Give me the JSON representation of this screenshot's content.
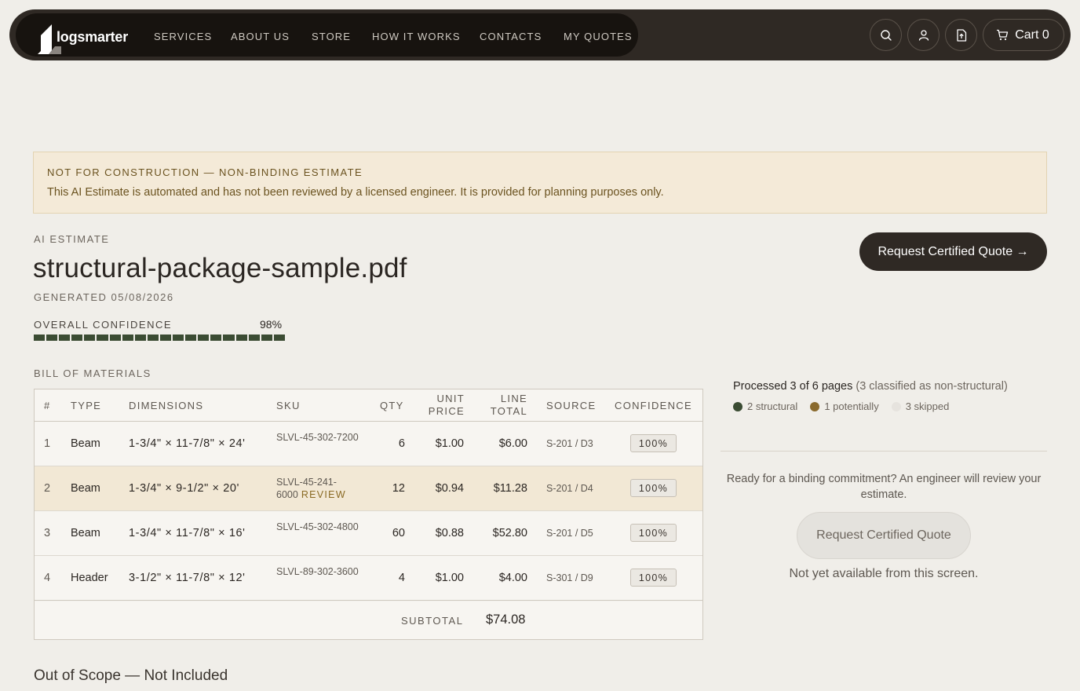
{
  "brand": {
    "name": "logsmarter"
  },
  "nav": {
    "items": [
      "SERVICES",
      "ABOUT US",
      "STORE",
      "HOW IT WORKS",
      "CONTACTS",
      "MY QUOTES"
    ]
  },
  "header_actions": {
    "cart_label": "Cart 0"
  },
  "notice": {
    "heading": "NOT FOR CONSTRUCTION — NON-BINDING ESTIMATE",
    "body": "This AI Estimate is automated and has not been reviewed by a licensed engineer. It is provided for planning purposes only."
  },
  "estimate": {
    "eyebrow": "AI ESTIMATE",
    "filename": "structural-package-sample.pdf",
    "generated": "GENERATED 05/08/2026",
    "confidence_label": "OVERALL CONFIDENCE",
    "confidence_value": "98%",
    "confidence_fraction": 0.98,
    "cta_label": "Request Certified Quote →"
  },
  "bom": {
    "label": "BILL OF MATERIALS",
    "columns": {
      "num": "#",
      "type": "TYPE",
      "dimensions": "DIMENSIONS",
      "sku": "SKU",
      "qty": "QTY",
      "unit_price": "UNIT PRICE",
      "line_total": "LINE TOTAL",
      "source": "SOURCE",
      "confidence": "CONFIDENCE"
    },
    "rows": [
      {
        "num": "1",
        "type": "Beam",
        "dimensions": "1-3/4\" × 11-7/8\" × 24'",
        "sku": "SLVL-45-302-7200",
        "review": "",
        "qty": "6",
        "unit_price": "$1.00",
        "line_total": "$6.00",
        "source": "S-201 / D3",
        "confidence": "100%"
      },
      {
        "num": "2",
        "type": "Beam",
        "dimensions": "1-3/4\" × 9-1/2\" × 20'",
        "sku": "SLVL-45-241-6000",
        "review": "REVIEW",
        "qty": "12",
        "unit_price": "$0.94",
        "line_total": "$11.28",
        "source": "S-201 / D4",
        "confidence": "100%"
      },
      {
        "num": "3",
        "type": "Beam",
        "dimensions": "1-3/4\" × 11-7/8\" × 16'",
        "sku": "SLVL-45-302-4800",
        "review": "",
        "qty": "60",
        "unit_price": "$0.88",
        "line_total": "$52.80",
        "source": "S-201 / D5",
        "confidence": "100%"
      },
      {
        "num": "4",
        "type": "Header",
        "dimensions": "3-1/2\" × 11-7/8\" × 12'",
        "sku": "SLVL-89-302-3600",
        "review": "",
        "qty": "4",
        "unit_price": "$1.00",
        "line_total": "$4.00",
        "source": "S-301 / D9",
        "confidence": "100%"
      }
    ],
    "subtotal_label": "SUBTOTAL",
    "subtotal_value": "$74.08"
  },
  "side": {
    "processed_main": "Processed 3 of 6 pages",
    "processed_note": "(3 classified as non-structural)",
    "legend": [
      {
        "label": "2 structural",
        "color": "#3b4c33"
      },
      {
        "label": "1 potentially",
        "color": "#8a6a2e"
      },
      {
        "label": "3 skipped",
        "color": "#e6e3de"
      }
    ],
    "ready_text": "Ready for a binding commitment? An engineer will review your estimate.",
    "cta_label": "Request Certified Quote",
    "not_available": "Not yet available from this screen."
  },
  "out_of_scope": {
    "title": "Out of Scope — Not Included"
  }
}
